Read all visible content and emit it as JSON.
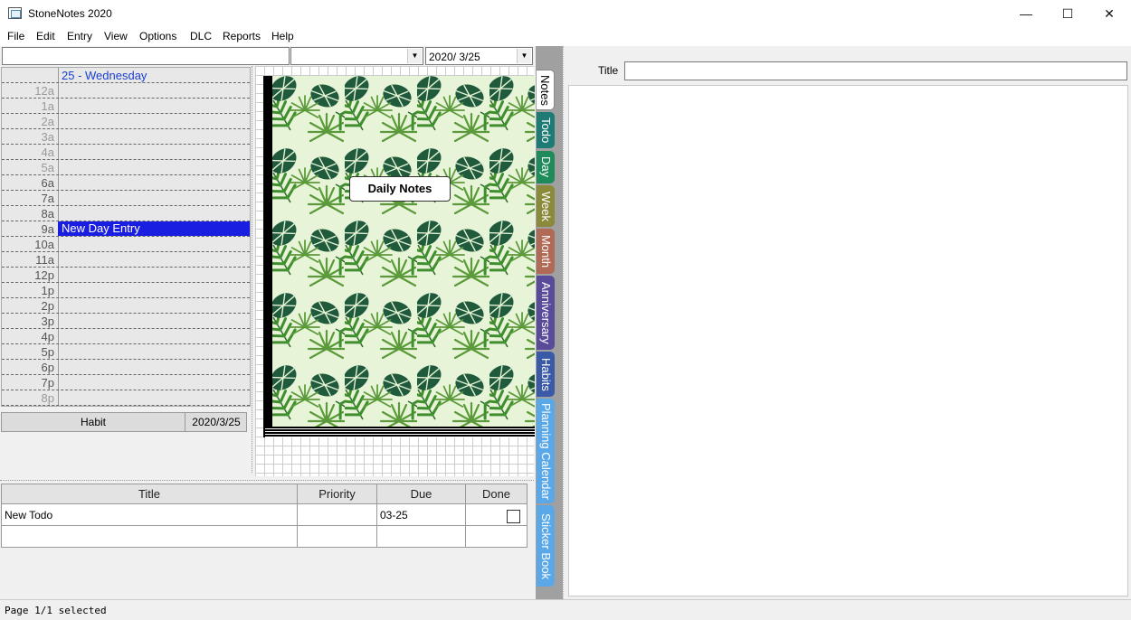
{
  "window": {
    "title": "StoneNotes 2020",
    "minimize": "—",
    "maximize": "☐",
    "close": "✕"
  },
  "menu": [
    "File",
    "Edit",
    "Entry",
    "View",
    "Options",
    "DLC",
    "Reports",
    "Help"
  ],
  "toolbar": {
    "search_value": "",
    "filter_value": "",
    "date_value": "2020/  3/25"
  },
  "day_view": {
    "header": "25 - Wednesday",
    "hours": [
      {
        "label": "12a",
        "dim": true
      },
      {
        "label": "1a",
        "dim": true
      },
      {
        "label": "2a",
        "dim": true
      },
      {
        "label": "3a",
        "dim": true
      },
      {
        "label": "4a",
        "dim": true
      },
      {
        "label": "5a",
        "dim": true
      },
      {
        "label": "6a",
        "dim": false
      },
      {
        "label": "7a",
        "dim": false
      },
      {
        "label": "8a",
        "dim": false
      },
      {
        "label": "9a",
        "dim": false
      },
      {
        "label": "10a",
        "dim": false
      },
      {
        "label": "11a",
        "dim": false
      },
      {
        "label": "12p",
        "dim": false
      },
      {
        "label": "1p",
        "dim": false
      },
      {
        "label": "2p",
        "dim": false
      },
      {
        "label": "3p",
        "dim": false
      },
      {
        "label": "4p",
        "dim": false
      },
      {
        "label": "5p",
        "dim": false
      },
      {
        "label": "6p",
        "dim": false
      },
      {
        "label": "7p",
        "dim": false
      },
      {
        "label": "8p",
        "dim": true
      }
    ],
    "entry_hour": "9a",
    "entry_text": "New Day Entry"
  },
  "habit": {
    "label": "Habit",
    "date": "2020/3/25"
  },
  "notebook": {
    "label": "Daily Notes"
  },
  "todo": {
    "columns": [
      "Title",
      "Priority",
      "Due",
      "Done"
    ],
    "rows": [
      {
        "title": "New Todo",
        "priority": "",
        "due": "03-25",
        "done": false
      }
    ]
  },
  "tabs": [
    {
      "label": "Notes",
      "color": "#ffffff",
      "text": "#000000"
    },
    {
      "label": "Todo",
      "color": "#1e7a74",
      "text": "#ffffff"
    },
    {
      "label": "Day",
      "color": "#1f8a5a",
      "text": "#ffffff"
    },
    {
      "label": "Week",
      "color": "#8a8a3a",
      "text": "#ffffff"
    },
    {
      "label": "Month",
      "color": "#b06a55",
      "text": "#ffffff"
    },
    {
      "label": "Anniversary",
      "color": "#5a4a9a",
      "text": "#ffffff"
    },
    {
      "label": "Habits",
      "color": "#3a5aa8",
      "text": "#ffffff"
    },
    {
      "label": "Planning Calendar",
      "color": "#5aa8e8",
      "text": "#ffffff"
    },
    {
      "label": "Sticker Book",
      "color": "#5aa8e8",
      "text": "#ffffff"
    }
  ],
  "note": {
    "title_label": "Title",
    "title_value": "",
    "body": ""
  },
  "status": {
    "text": "Page 1/1 selected"
  }
}
